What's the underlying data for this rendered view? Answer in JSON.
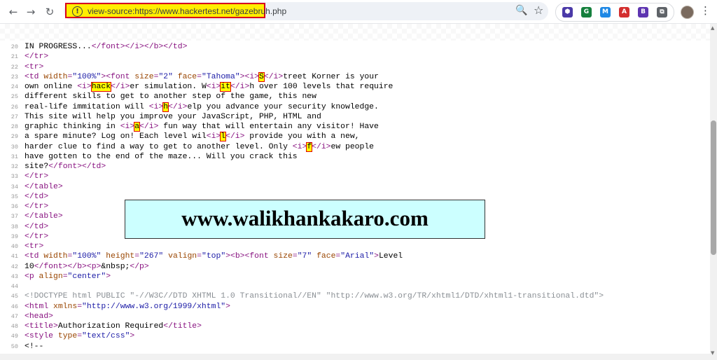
{
  "toolbar": {
    "back_icon": "←",
    "forward_icon": "→",
    "reload_icon": "↻",
    "url": "view-source:https://www.hackertest.net/gazebruh.php",
    "zoom_icon": "🔍",
    "star_icon": "☆",
    "menu_icon": "⋮",
    "extensions": [
      {
        "label": "⬢",
        "color": "#4b3aa8"
      },
      {
        "label": "G",
        "color": "#15803d"
      },
      {
        "label": "M",
        "color": "#1e88e5"
      },
      {
        "label": "A",
        "color": "#d32f2f"
      },
      {
        "label": "B",
        "color": "#5e35b1"
      },
      {
        "label": "⧉",
        "color": "#5f6368"
      }
    ]
  },
  "banner": {
    "text": "www.walikhankakaro.com"
  },
  "lines": [
    {
      "n": "20",
      "segs": [
        {
          "t": "IN PROGRESS...",
          "c": "txt"
        },
        {
          "t": "</font></i></b></td>",
          "c": "tag"
        }
      ]
    },
    {
      "n": "21",
      "segs": [
        {
          "t": "</tr>",
          "c": "tag"
        }
      ]
    },
    {
      "n": "22",
      "segs": [
        {
          "t": "<tr>",
          "c": "tag"
        }
      ]
    },
    {
      "n": "23",
      "segs": [
        {
          "t": "<td ",
          "c": "tag"
        },
        {
          "t": "width",
          "c": "an"
        },
        {
          "t": "=",
          "c": "tag"
        },
        {
          "t": "\"100%\"",
          "c": "av"
        },
        {
          "t": "><font ",
          "c": "tag"
        },
        {
          "t": "size",
          "c": "an"
        },
        {
          "t": "=",
          "c": "tag"
        },
        {
          "t": "\"2\"",
          "c": "av"
        },
        {
          "t": " ",
          "c": "tag"
        },
        {
          "t": "face",
          "c": "an"
        },
        {
          "t": "=",
          "c": "tag"
        },
        {
          "t": "\"Tahoma\"",
          "c": "av"
        },
        {
          "t": "><i>",
          "c": "tag"
        },
        {
          "t": "S",
          "c": "hl"
        },
        {
          "t": "</i>",
          "c": "tag"
        },
        {
          "t": "treet Korner is your",
          "c": "txt"
        }
      ]
    },
    {
      "n": "24",
      "segs": [
        {
          "t": "own online ",
          "c": "txt"
        },
        {
          "t": "<i>",
          "c": "tag"
        },
        {
          "t": "hack",
          "c": "hl"
        },
        {
          "t": "</i>",
          "c": "tag"
        },
        {
          "t": "er simulation. W",
          "c": "txt"
        },
        {
          "t": "<i>",
          "c": "tag"
        },
        {
          "t": "it",
          "c": "hl"
        },
        {
          "t": "</i>",
          "c": "tag"
        },
        {
          "t": "h over 100 levels that require",
          "c": "txt"
        }
      ]
    },
    {
      "n": "25",
      "segs": [
        {
          "t": "different skills to get to another step of the game, this new",
          "c": "txt"
        }
      ]
    },
    {
      "n": "26",
      "segs": [
        {
          "t": "real-life immitation will ",
          "c": "txt"
        },
        {
          "t": "<i>",
          "c": "tag"
        },
        {
          "t": "h",
          "c": "hl"
        },
        {
          "t": "</i>",
          "c": "tag"
        },
        {
          "t": "elp you advance your security knowledge.",
          "c": "txt"
        }
      ]
    },
    {
      "n": "27",
      "segs": [
        {
          "t": "This site will help you improve your JavaScript, PHP, HTML and",
          "c": "txt"
        }
      ]
    },
    {
      "n": "28",
      "segs": [
        {
          "t": "graphic thinking in ",
          "c": "txt"
        },
        {
          "t": "<i>",
          "c": "tag"
        },
        {
          "t": "a",
          "c": "hl"
        },
        {
          "t": "</i>",
          "c": "tag"
        },
        {
          "t": " fun way that will entertain any visitor! Have",
          "c": "txt"
        }
      ]
    },
    {
      "n": "29",
      "segs": [
        {
          "t": "a spare minute? Log on! Each level wil",
          "c": "txt"
        },
        {
          "t": "<i>",
          "c": "tag"
        },
        {
          "t": "l",
          "c": "hl"
        },
        {
          "t": "</i>",
          "c": "tag"
        },
        {
          "t": " provide you with a new,",
          "c": "txt"
        }
      ]
    },
    {
      "n": "30",
      "segs": [
        {
          "t": "harder clue to find a way to get to another level. Only ",
          "c": "txt"
        },
        {
          "t": "<i>",
          "c": "tag"
        },
        {
          "t": "f",
          "c": "hl"
        },
        {
          "t": "</i>",
          "c": "tag"
        },
        {
          "t": "ew people",
          "c": "txt"
        }
      ]
    },
    {
      "n": "31",
      "segs": [
        {
          "t": "have gotten to the end of the maze... Will you crack this",
          "c": "txt"
        }
      ]
    },
    {
      "n": "32",
      "segs": [
        {
          "t": "site?",
          "c": "txt"
        },
        {
          "t": "</font></td>",
          "c": "tag"
        }
      ]
    },
    {
      "n": "33",
      "segs": [
        {
          "t": "</tr>",
          "c": "tag"
        }
      ]
    },
    {
      "n": "34",
      "segs": [
        {
          "t": "</table>",
          "c": "tag"
        }
      ]
    },
    {
      "n": "35",
      "segs": [
        {
          "t": "</td>",
          "c": "tag"
        }
      ]
    },
    {
      "n": "36",
      "segs": [
        {
          "t": "</tr>",
          "c": "tag"
        }
      ]
    },
    {
      "n": "37",
      "segs": [
        {
          "t": "</table>",
          "c": "tag"
        }
      ]
    },
    {
      "n": "38",
      "segs": [
        {
          "t": "</td>",
          "c": "tag"
        }
      ]
    },
    {
      "n": "39",
      "segs": [
        {
          "t": "</tr>",
          "c": "tag"
        }
      ]
    },
    {
      "n": "40",
      "segs": [
        {
          "t": "<tr>",
          "c": "tag"
        }
      ]
    },
    {
      "n": "41",
      "segs": [
        {
          "t": "<td ",
          "c": "tag"
        },
        {
          "t": "width",
          "c": "an"
        },
        {
          "t": "=",
          "c": "tag"
        },
        {
          "t": "\"100%\"",
          "c": "av"
        },
        {
          "t": " ",
          "c": "tag"
        },
        {
          "t": "height",
          "c": "an"
        },
        {
          "t": "=",
          "c": "tag"
        },
        {
          "t": "\"267\"",
          "c": "av"
        },
        {
          "t": " ",
          "c": "tag"
        },
        {
          "t": "valign",
          "c": "an"
        },
        {
          "t": "=",
          "c": "tag"
        },
        {
          "t": "\"top\"",
          "c": "av"
        },
        {
          "t": "><b><font ",
          "c": "tag"
        },
        {
          "t": "size",
          "c": "an"
        },
        {
          "t": "=",
          "c": "tag"
        },
        {
          "t": "\"7\"",
          "c": "av"
        },
        {
          "t": " ",
          "c": "tag"
        },
        {
          "t": "face",
          "c": "an"
        },
        {
          "t": "=",
          "c": "tag"
        },
        {
          "t": "\"Arial\"",
          "c": "av"
        },
        {
          "t": ">",
          "c": "tag"
        },
        {
          "t": "Level",
          "c": "txt"
        }
      ]
    },
    {
      "n": "42",
      "segs": [
        {
          "t": "10",
          "c": "txt"
        },
        {
          "t": "</font></b><p>",
          "c": "tag"
        },
        {
          "t": "&nbsp;",
          "c": "txt"
        },
        {
          "t": "</p>",
          "c": "tag"
        }
      ]
    },
    {
      "n": "43",
      "segs": [
        {
          "t": "<p ",
          "c": "tag"
        },
        {
          "t": "align",
          "c": "an"
        },
        {
          "t": "=",
          "c": "tag"
        },
        {
          "t": "\"center\"",
          "c": "av"
        },
        {
          "t": ">",
          "c": "tag"
        }
      ]
    },
    {
      "n": "44",
      "segs": []
    },
    {
      "n": "45",
      "segs": [
        {
          "t": "<!DOCTYPE html PUBLIC \"-//W3C//DTD XHTML 1.0 Transitional//EN\" \"http://www.w3.org/TR/xhtml1/DTD/xhtml1-transitional.dtd\">",
          "c": "cm"
        }
      ]
    },
    {
      "n": "46",
      "segs": [
        {
          "t": "<html ",
          "c": "tag"
        },
        {
          "t": "xmlns",
          "c": "an"
        },
        {
          "t": "=",
          "c": "tag"
        },
        {
          "t": "\"http://www.w3.org/1999/xhtml\"",
          "c": "av"
        },
        {
          "t": ">",
          "c": "tag"
        }
      ]
    },
    {
      "n": "47",
      "segs": [
        {
          "t": "<head>",
          "c": "tag"
        }
      ]
    },
    {
      "n": "48",
      "segs": [
        {
          "t": "<title>",
          "c": "tag"
        },
        {
          "t": "Authorization Required",
          "c": "txt"
        },
        {
          "t": "</title>",
          "c": "tag"
        }
      ]
    },
    {
      "n": "49",
      "segs": [
        {
          "t": "<style ",
          "c": "tag"
        },
        {
          "t": "type",
          "c": "an"
        },
        {
          "t": "=",
          "c": "tag"
        },
        {
          "t": "\"text/css\"",
          "c": "av"
        },
        {
          "t": ">",
          "c": "tag"
        }
      ]
    },
    {
      "n": "50",
      "segs": [
        {
          "t": "<!--",
          "c": "txt"
        }
      ]
    }
  ]
}
